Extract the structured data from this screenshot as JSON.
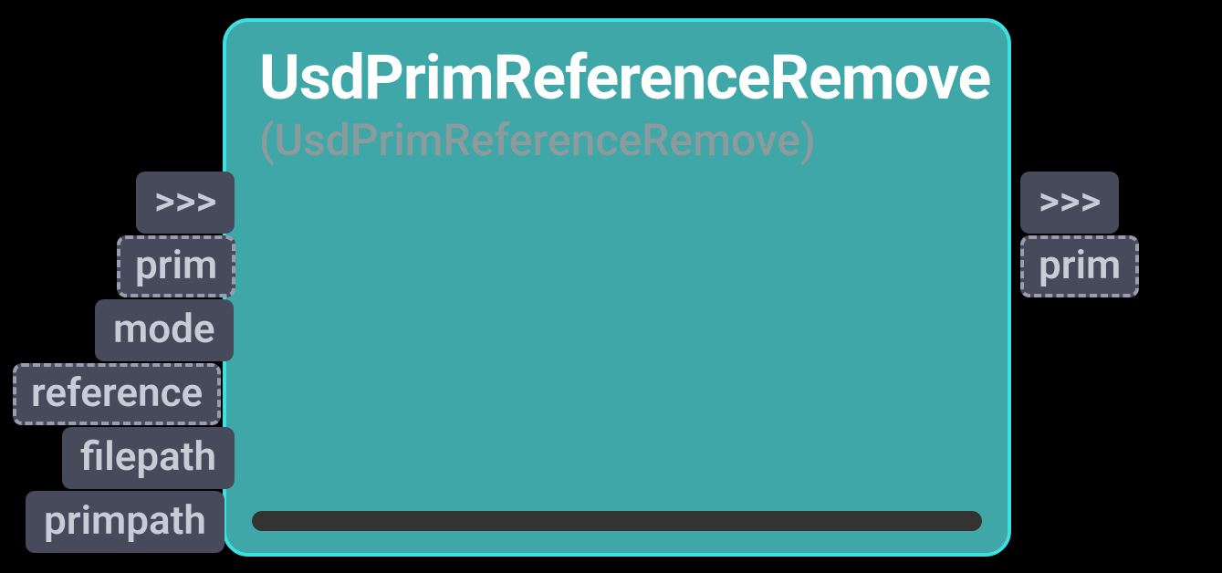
{
  "node": {
    "title": "UsdPrimReferenceRemove",
    "subtitle": "(UsdPrimReferenceRemove)"
  },
  "inputs": {
    "exec": ">>>",
    "prim": "prim",
    "mode": "mode",
    "reference": "reference",
    "filepath": "filepath",
    "primpath": "primpath"
  },
  "outputs": {
    "exec": ">>>",
    "prim": "prim"
  }
}
